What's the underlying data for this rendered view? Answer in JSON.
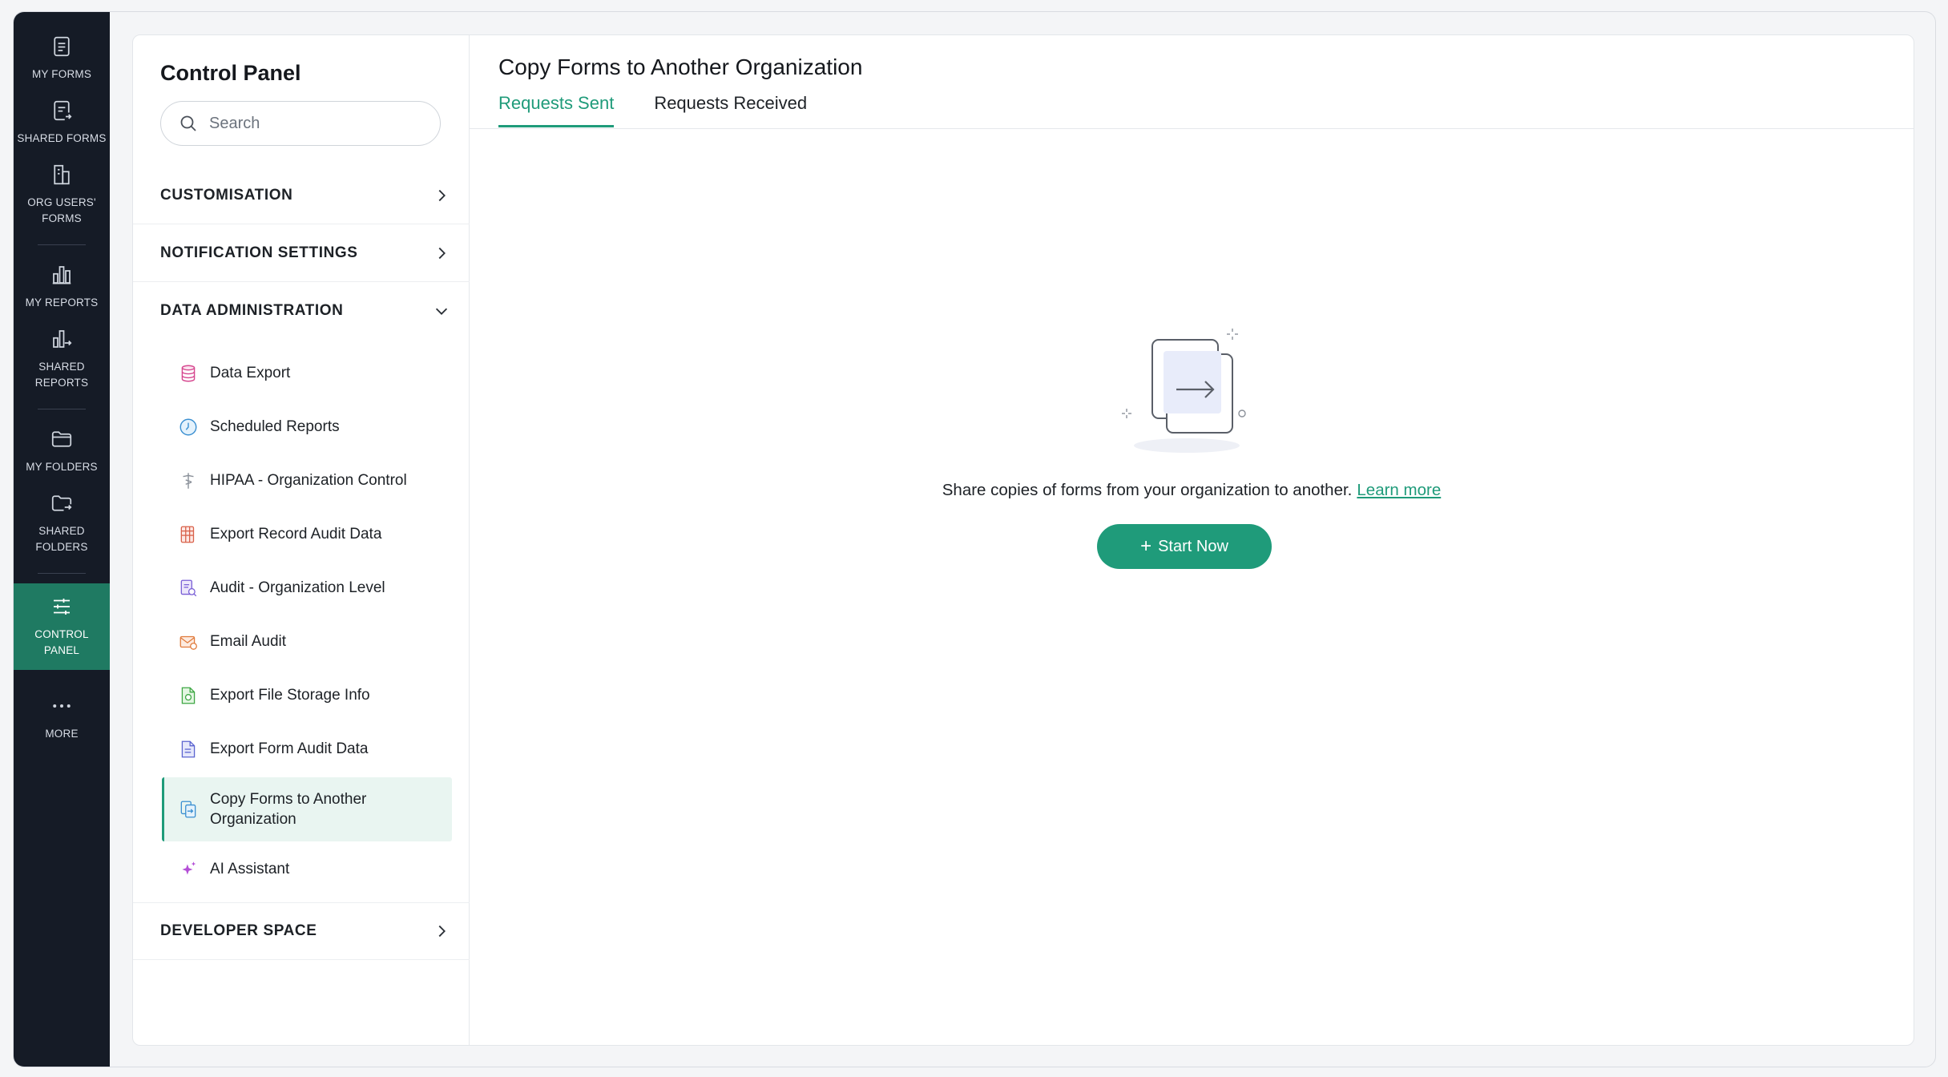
{
  "rail": {
    "my_forms": "MY FORMS",
    "shared_forms": "SHARED FORMS",
    "org_users_forms_1": "ORG USERS'",
    "org_users_forms_2": "FORMS",
    "my_reports": "MY REPORTS",
    "shared_reports_1": "SHARED",
    "shared_reports_2": "REPORTS",
    "my_folders": "MY FOLDERS",
    "shared_folders_1": "SHARED",
    "shared_folders_2": "FOLDERS",
    "control_panel_1": "CONTROL",
    "control_panel_2": "PANEL",
    "more": "MORE"
  },
  "panel": {
    "title": "Control Panel",
    "search_placeholder": "Search",
    "sections": {
      "customisation": "CUSTOMISATION",
      "notification": "NOTIFICATION SETTINGS",
      "data_admin": "DATA ADMINISTRATION",
      "developer": "DEVELOPER SPACE"
    },
    "items": {
      "data_export": "Data Export",
      "scheduled_reports": "Scheduled Reports",
      "hipaa": "HIPAA - Organization Control",
      "export_record_audit": "Export Record Audit Data",
      "audit_org": "Audit - Organization Level",
      "email_audit": "Email Audit",
      "export_file_storage": "Export File Storage Info",
      "export_form_audit": "Export Form Audit Data",
      "copy_forms_1": "Copy Forms to Another",
      "copy_forms_2": "Organization",
      "ai_assistant": "AI Assistant"
    }
  },
  "main": {
    "title": "Copy Forms to Another Organization",
    "tabs": {
      "sent": "Requests Sent",
      "received": "Requests Received"
    },
    "empty_text": "Share copies of forms from your organization to another.",
    "learn_more": "Learn more",
    "start_now": "Start Now"
  },
  "colors": {
    "accent": "#1f9b7a",
    "rail_bg": "#151b26",
    "rail_active": "#1f7a62"
  }
}
